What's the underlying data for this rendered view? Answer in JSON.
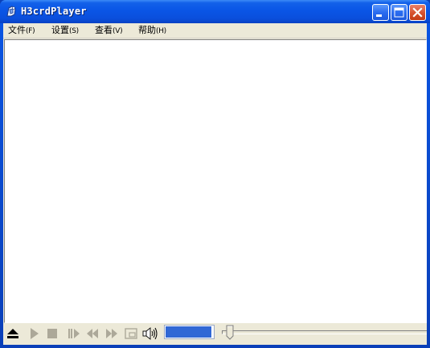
{
  "window": {
    "title": "H3crdPlayer",
    "app_icon": "player-app-icon"
  },
  "title_buttons": {
    "minimize_icon": "minimize-icon",
    "maximize_icon": "maximize-icon",
    "close_icon": "close-icon"
  },
  "menu": {
    "items": [
      {
        "label": "文件",
        "accel": "(F)"
      },
      {
        "label": "设置",
        "accel": "(S)"
      },
      {
        "label": "查看",
        "accel": "(V)"
      },
      {
        "label": "帮助",
        "accel": "(H)"
      }
    ]
  },
  "controls": {
    "icons": [
      "eject-icon",
      "play-icon",
      "stop-icon",
      "frame-step-icon",
      "rewind-icon",
      "fast-forward-icon",
      "snapshot-icon",
      "speaker-icon"
    ],
    "volume_level": 0.97,
    "seek_position": 0.02
  },
  "colors": {
    "titlebar": "#0a55e6",
    "close_button": "#d6512e",
    "face": "#ece9d8",
    "volume_fill": "#3168d5"
  }
}
